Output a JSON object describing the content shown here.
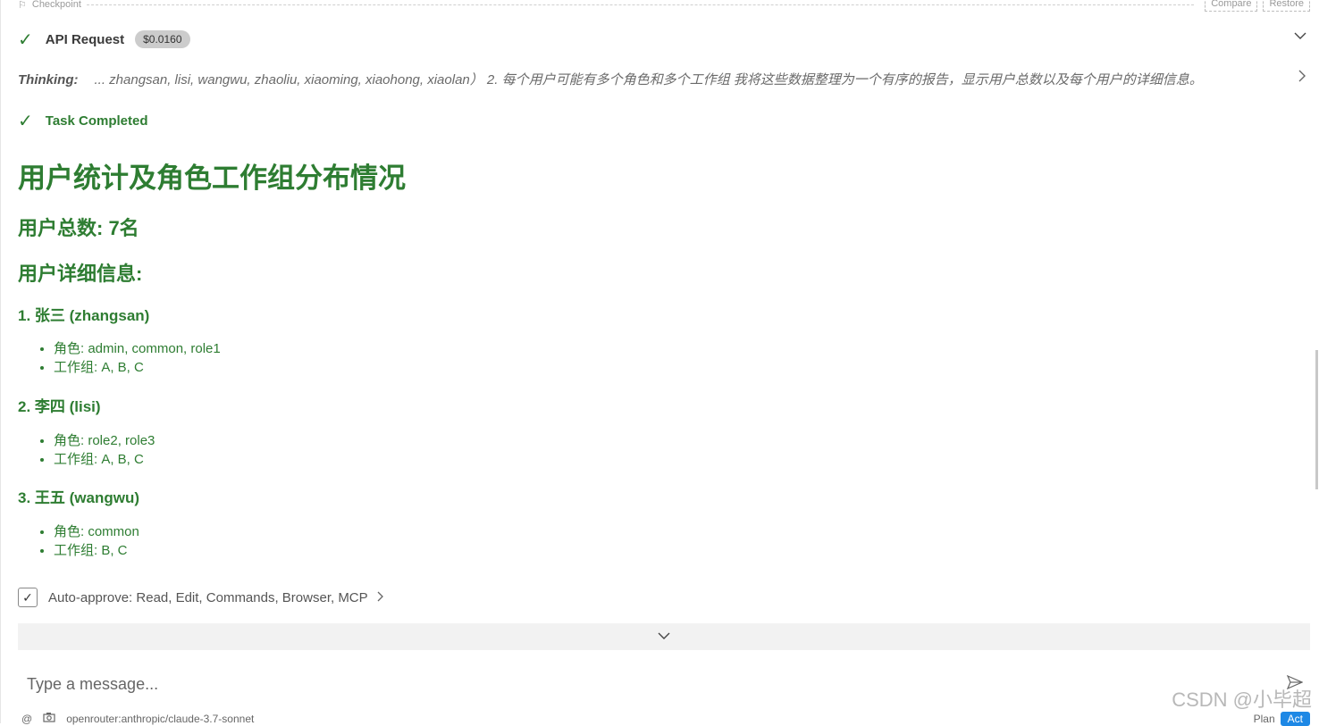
{
  "checkpoint": {
    "label": "Checkpoint",
    "compare": "Compare",
    "restore": "Restore"
  },
  "api_request": {
    "title": "API Request",
    "cost": "$0.0160"
  },
  "thinking": {
    "label": "Thinking:",
    "text": "... zhangsan, lisi, wangwu, zhaoliu, xiaoming, xiaohong, xiaolan） 2. 每个用户可能有多个角色和多个工作组 我将这些数据整理为一个有序的报告，显示用户总数以及每个用户的详细信息。"
  },
  "task": {
    "title": "Task Completed"
  },
  "report": {
    "title": "用户统计及角色工作组分布情况",
    "total": "用户总数: 7名",
    "details_heading": "用户详细信息:",
    "users": [
      {
        "heading": "1. 张三 (zhangsan)",
        "roles": "角色: admin, common, role1",
        "groups": "工作组: A, B, C"
      },
      {
        "heading": "2. 李四 (lisi)",
        "roles": "角色: role2, role3",
        "groups": "工作组: A, B, C"
      },
      {
        "heading": "3. 王五 (wangwu)",
        "roles": "角色: common",
        "groups": "工作组: B, C"
      }
    ]
  },
  "auto_approve": {
    "label": "Auto-approve: Read, Edit, Commands, Browser, MCP"
  },
  "input": {
    "placeholder": "Type a message..."
  },
  "footer": {
    "model": "openrouter:anthropic/claude-3.7-sonnet",
    "plan": "Plan",
    "act": "Act"
  },
  "watermark": "CSDN @小毕超",
  "colors": {
    "accent_green": "#2e7d32",
    "act_blue": "#1e88e5"
  }
}
